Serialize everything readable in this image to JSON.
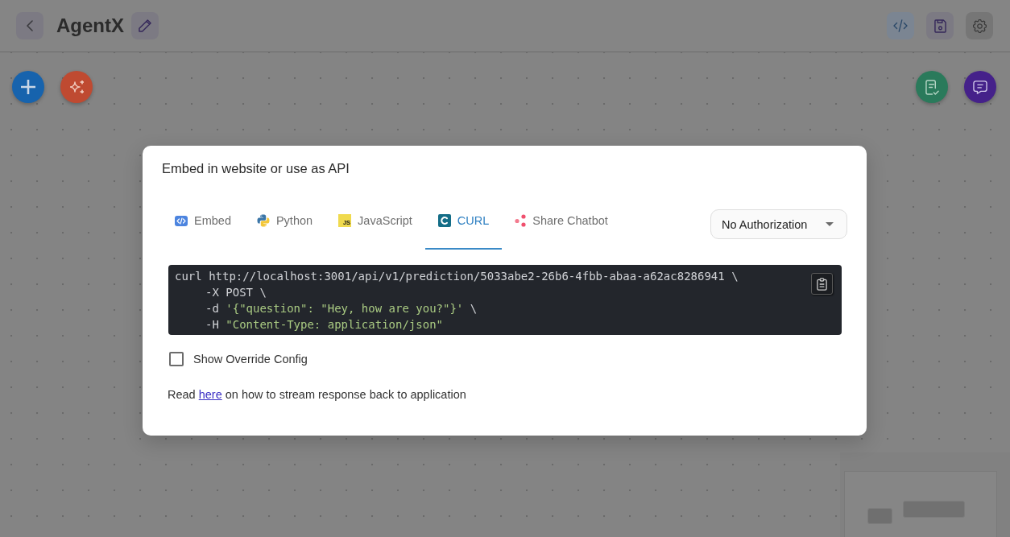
{
  "header": {
    "title": "AgentX"
  },
  "dialog": {
    "title": "Embed in website or use as API",
    "tabs": [
      {
        "kind": "embed",
        "label": "Embed",
        "selected": false
      },
      {
        "kind": "python",
        "label": "Python",
        "selected": false
      },
      {
        "kind": "javascript",
        "label": "JavaScript",
        "badge": "JS",
        "selected": false
      },
      {
        "kind": "curl",
        "label": "CURL",
        "selected": true
      },
      {
        "kind": "share",
        "label": "Share Chatbot",
        "selected": false
      }
    ],
    "authorization": {
      "value": "No Authorization"
    },
    "code": {
      "lines": [
        {
          "parts": [
            {
              "kind": "plain",
              "text": "curl http://localhost:3001/api/v1/prediction/5033abe2-26b6-4fbb-abaa-a62ac8286941 \\"
            }
          ],
          "children": [
            {
              "parts": [
                {
                  "kind": "plain",
                  "text": "-X POST \\"
                }
              ]
            },
            {
              "parts": [
                {
                  "kind": "plain",
                  "text": "-d"
                },
                {
                  "kind": "string",
                  "text": "'{\"question\": \"Hey, how are you?\"}'"
                },
                {
                  "kind": "plain",
                  "text": "\\"
                }
              ]
            },
            {
              "parts": [
                {
                  "kind": "plain",
                  "text": "-H"
                },
                {
                  "kind": "string",
                  "text": "\"Content-Type: application/json\""
                }
              ]
            }
          ]
        }
      ]
    },
    "override_config": {
      "label": "Show Override Config",
      "checked": false
    },
    "note": {
      "before": "Read",
      "link": "here",
      "after": "on how to stream response back to application"
    }
  }
}
